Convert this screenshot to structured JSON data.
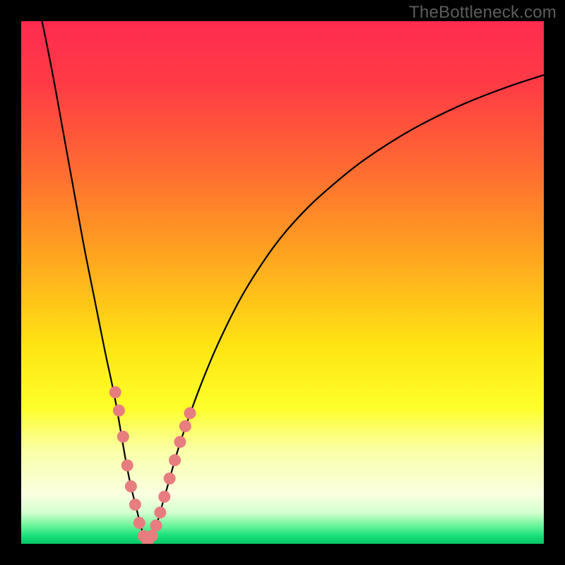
{
  "watermark": "TheBottleneck.com",
  "colors": {
    "frame": "#000000",
    "gradient_stops": [
      {
        "offset": 0.0,
        "color": "#ff2b4f"
      },
      {
        "offset": 0.12,
        "color": "#ff3b45"
      },
      {
        "offset": 0.28,
        "color": "#ff6a32"
      },
      {
        "offset": 0.45,
        "color": "#ffa51f"
      },
      {
        "offset": 0.62,
        "color": "#ffe413"
      },
      {
        "offset": 0.74,
        "color": "#fdff2a"
      },
      {
        "offset": 0.82,
        "color": "#faffa6"
      },
      {
        "offset": 0.905,
        "color": "#faffe1"
      },
      {
        "offset": 0.94,
        "color": "#d5ffd0"
      },
      {
        "offset": 0.965,
        "color": "#6cf59a"
      },
      {
        "offset": 0.985,
        "color": "#18e07a"
      },
      {
        "offset": 1.0,
        "color": "#07c566"
      }
    ],
    "curve": "#000000",
    "marker_fill": "#e77d7e",
    "marker_stroke": "#d46a6c"
  },
  "chart_data": {
    "type": "line",
    "title": "",
    "xlabel": "",
    "ylabel": "",
    "xlim": [
      0,
      100
    ],
    "ylim": [
      0,
      100
    ],
    "series": [
      {
        "name": "bottleneck-curve",
        "comment": "V-shaped curve; y is bottleneck % (0 at ~x=24). Values estimated from pixel positions.",
        "x": [
          4,
          6,
          8,
          10,
          12,
          14,
          16,
          18,
          20,
          21,
          22,
          23,
          24,
          25,
          26,
          27,
          28,
          30,
          32,
          35,
          38,
          42,
          46,
          50,
          55,
          60,
          65,
          70,
          75,
          80,
          85,
          90,
          95,
          100
        ],
        "values": [
          100,
          90,
          79,
          68,
          57,
          47,
          37,
          27.5,
          16,
          11,
          7,
          3,
          0.5,
          1.5,
          4,
          7.5,
          11,
          18,
          24,
          32,
          39,
          47,
          53.5,
          59,
          64.5,
          69,
          73,
          76.4,
          79.4,
          82,
          84.3,
          86.3,
          88.1,
          89.7
        ]
      }
    ],
    "markers": {
      "name": "highlighted-points",
      "comment": "Pink dot markers clustered near the valley on both branches.",
      "points": [
        {
          "x": 18.0,
          "y": 29.0
        },
        {
          "x": 18.7,
          "y": 25.5
        },
        {
          "x": 19.5,
          "y": 20.5
        },
        {
          "x": 20.3,
          "y": 15.0
        },
        {
          "x": 21.0,
          "y": 11.0
        },
        {
          "x": 21.8,
          "y": 7.5
        },
        {
          "x": 22.6,
          "y": 4.0
        },
        {
          "x": 23.4,
          "y": 1.5
        },
        {
          "x": 24.2,
          "y": 0.6
        },
        {
          "x": 25.0,
          "y": 1.5
        },
        {
          "x": 25.8,
          "y": 3.5
        },
        {
          "x": 26.6,
          "y": 6.0
        },
        {
          "x": 27.4,
          "y": 9.0
        },
        {
          "x": 28.4,
          "y": 12.5
        },
        {
          "x": 29.4,
          "y": 16.0
        },
        {
          "x": 30.4,
          "y": 19.5
        },
        {
          "x": 31.4,
          "y": 22.5
        },
        {
          "x": 32.3,
          "y": 25.0
        }
      ]
    }
  }
}
